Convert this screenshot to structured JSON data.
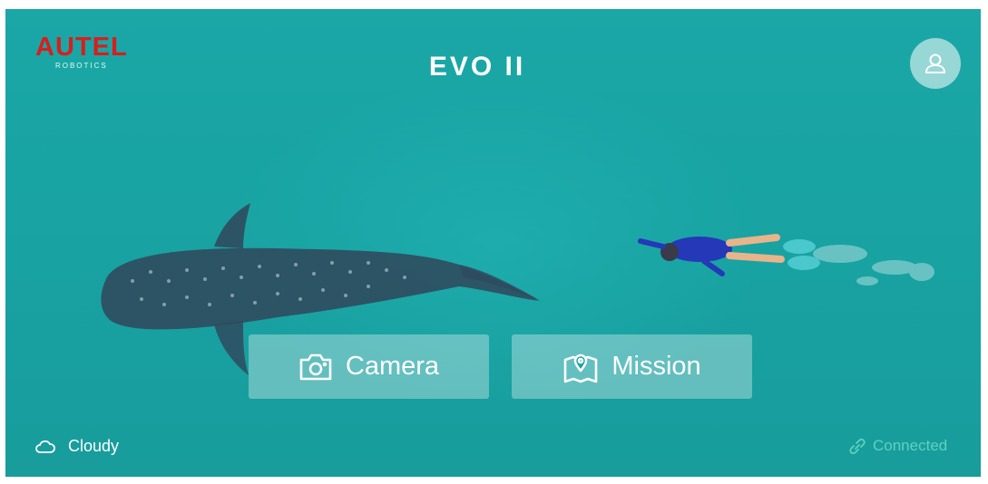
{
  "brand": {
    "logo_main": "AUTEL",
    "logo_sub": "ROBOTICS"
  },
  "product": {
    "title": "EVO II"
  },
  "header": {
    "avatar_icon": "user-icon"
  },
  "actions": [
    {
      "label": "Camera",
      "icon": "camera-icon"
    },
    {
      "label": "Mission",
      "icon": "map-pin-icon"
    }
  ],
  "status": {
    "weather": {
      "label": "Cloudy",
      "icon": "cloud-icon"
    },
    "connection": {
      "label": "Connected",
      "icon": "link-icon",
      "color": "#5fd1bd"
    }
  },
  "colors": {
    "background": "#19a3a3",
    "brand_red": "#d81e1e"
  }
}
